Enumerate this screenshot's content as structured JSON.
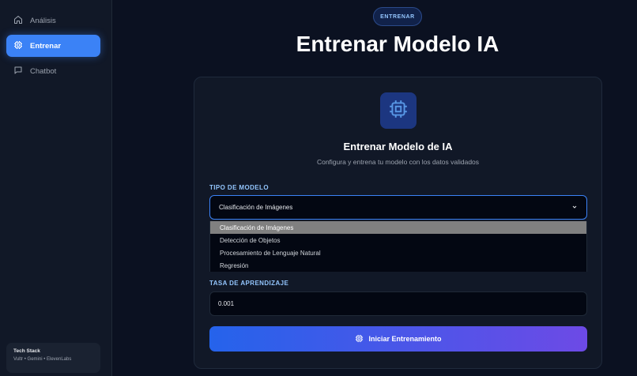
{
  "sidebar": {
    "items": [
      {
        "label": "Análisis",
        "icon": "home-icon",
        "active": false
      },
      {
        "label": "Entrenar",
        "icon": "chip-icon",
        "active": true
      },
      {
        "label": "Chatbot",
        "icon": "chat-icon",
        "active": false
      }
    ],
    "tech_stack": {
      "title": "Tech Stack",
      "list": "Vultr • Gemini • ElevenLabs"
    }
  },
  "header": {
    "badge": "ENTRENAR",
    "title": "Entrenar Modelo IA"
  },
  "card": {
    "icon": "chip-icon",
    "title": "Entrenar Modelo de IA",
    "subtitle": "Configura y entrena tu modelo con los datos validados",
    "model_type": {
      "label": "TIPO DE MODELO",
      "value": "Clasificación de Imágenes",
      "options": [
        "Clasificación de Imágenes",
        "Detección de Objetos",
        "Procesamiento de Lenguaje Natural",
        "Regresión"
      ],
      "selected_index": 0
    },
    "learning_rate": {
      "label": "TASA DE APRENDIZAJE",
      "value": "0.001"
    },
    "start_button": "Iniciar Entrenamiento"
  },
  "colors": {
    "accent": "#3b82f6",
    "background": "#0b1121",
    "sidebar": "#111827",
    "button_gradient_start": "#2563eb",
    "button_gradient_end": "#6d4ae6"
  }
}
